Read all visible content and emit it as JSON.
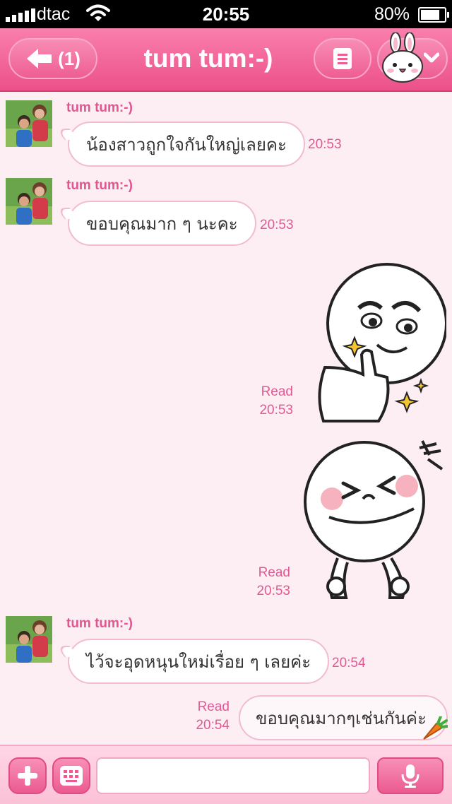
{
  "status_bar": {
    "carrier": "dtac",
    "time": "20:55",
    "battery_percent": "80%",
    "battery_level": 0.8,
    "signal_bars": 5
  },
  "header": {
    "back_count": "(1)",
    "title": "tum tum:-)"
  },
  "messages": [
    {
      "type": "incoming",
      "sender": "tum tum:-)",
      "text": "น้องสาวถูกใจกันใหญ่เลยคะ",
      "time": "20:53"
    },
    {
      "type": "incoming",
      "sender": "tum tum:-)",
      "text": "ขอบคุณมาก ๆ นะคะ",
      "time": "20:53"
    },
    {
      "type": "outgoing_sticker",
      "sticker": "thumbs-up-smirk-sticker",
      "status": "Read",
      "time": "20:53"
    },
    {
      "type": "outgoing_sticker",
      "sticker": "laughing-face-sticker",
      "status": "Read",
      "time": "20:53"
    },
    {
      "type": "incoming",
      "sender": "tum tum:-)",
      "text": "ไว้จะอุดหนุนใหม่เรื่อย ๆ เลยค่ะ",
      "time": "20:54"
    },
    {
      "type": "outgoing",
      "text": "ขอบคุณมากๆเช่นกันค่ะ",
      "status": "Read",
      "time": "20:54",
      "emoji": "carrot-icon"
    }
  ],
  "input": {
    "placeholder": "",
    "value": ""
  },
  "icons": {
    "back": "arrow-left-icon",
    "menu": "list-icon",
    "sticker": "bunny-sticker-icon",
    "plus": "plus-icon",
    "keyboard": "keyboard-icon",
    "mic": "microphone-icon"
  },
  "colors": {
    "header": "#ec5189",
    "accent_text": "#e2558e",
    "background": "#fdeef4"
  }
}
